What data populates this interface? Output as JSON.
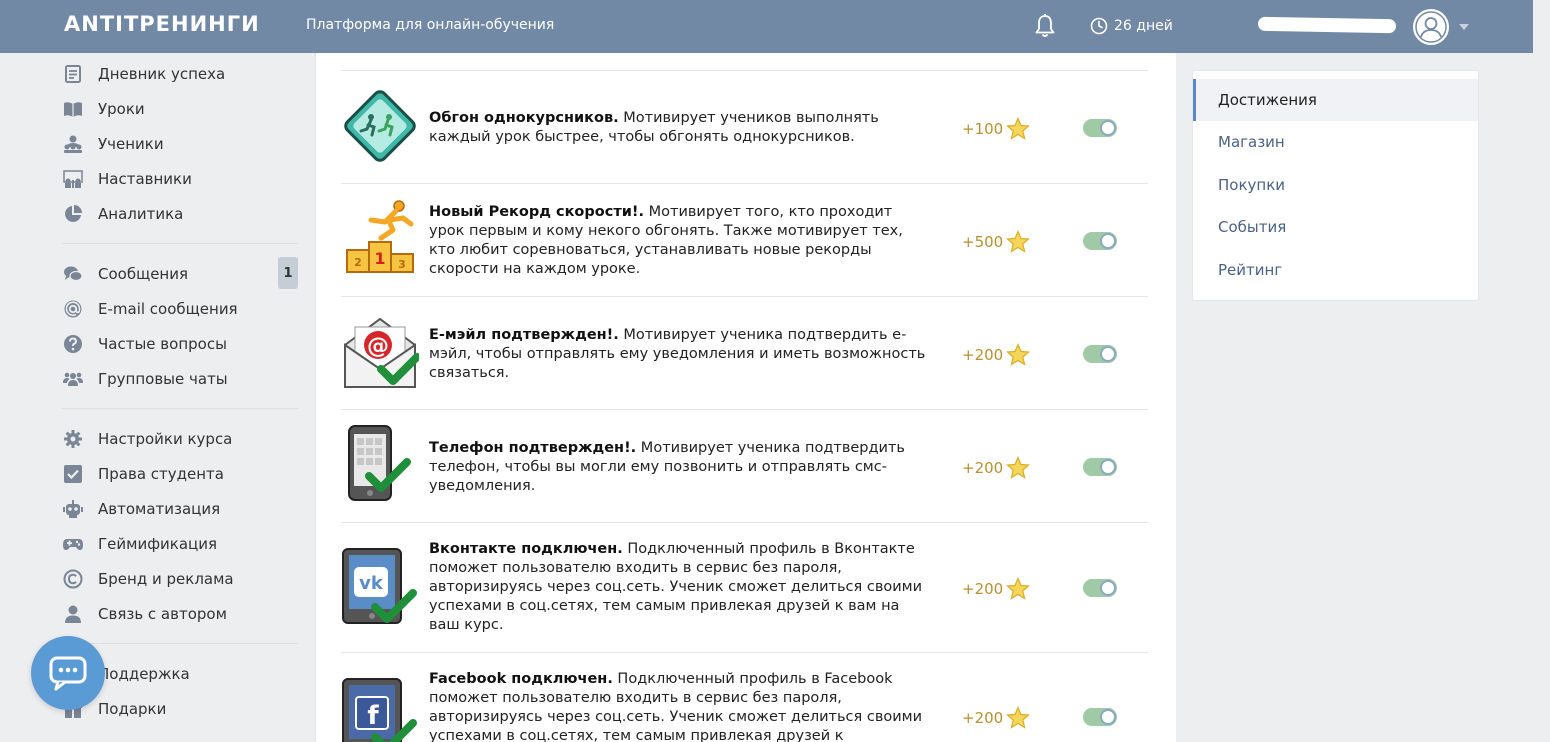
{
  "header": {
    "logo": "ANTITРЕНИНГИ",
    "tagline": "Платформа для онлайн-обучения",
    "days": "26 дней"
  },
  "sidebar": {
    "items": [
      {
        "label": "Дневник успеха",
        "icon": "diary-icon"
      },
      {
        "label": "Уроки",
        "icon": "book-icon"
      },
      {
        "label": "Ученики",
        "icon": "students-icon"
      },
      {
        "label": "Наставники",
        "icon": "mentors-icon"
      },
      {
        "label": "Аналитика",
        "icon": "pie-chart-icon"
      },
      {
        "label": "Сообщения",
        "icon": "messages-icon",
        "badge": "1"
      },
      {
        "label": "E-mail сообщения",
        "icon": "at-sign-icon"
      },
      {
        "label": "Частые вопросы",
        "icon": "question-icon"
      },
      {
        "label": "Групповые чаты",
        "icon": "group-icon"
      },
      {
        "label": "Настройки курса",
        "icon": "gear-icon"
      },
      {
        "label": "Права студента",
        "icon": "checkbox-icon"
      },
      {
        "label": "Автоматизация",
        "icon": "robot-icon"
      },
      {
        "label": "Геймификация",
        "icon": "gamepad-icon"
      },
      {
        "label": "Бренд и реклама",
        "icon": "copyright-icon"
      },
      {
        "label": "Связь с автором",
        "icon": "user-icon"
      },
      {
        "label": "Поддержка",
        "icon": "support-icon"
      },
      {
        "label": "Подарки",
        "icon": "gift-icon"
      }
    ]
  },
  "achievements": [
    {
      "title": "Обгон однокурсников.",
      "text": " Мотивирует учеников выполнять каждый урок быстрее, чтобы обгонять однокурсников.",
      "points": "+100"
    },
    {
      "title": "Новый Рекорд скорости!.",
      "text": " Мотивирует того, кто проходит урок первым и кому некого обгонять. Также мотивирует тех, кто любит соревноваться, устанавливать новые рекорды скорости на каждом уроке.",
      "points": "+500"
    },
    {
      "title": "Е-мэйл подтвержден!.",
      "text": " Мотивирует ученика подтвердить е-мэйл, чтобы отправлять ему уведомления и иметь возможность связаться.",
      "points": "+200"
    },
    {
      "title": "Телефон подтвержден!.",
      "text": " Мотивирует ученика подтвердить телефон, чтобы вы могли ему позвонить и отправлять смс-уведомления.",
      "points": "+200"
    },
    {
      "title": "Вконтакте подключен.",
      "text": " Подключенный профиль в Вконтакте поможет пользователю входить в сервис без пароля, авторизируясь через соц.сеть. Ученик сможет делиться своими успехами в соц.сетях, тем самым привлекая друзей к вам на ваш курс.",
      "points": "+200"
    },
    {
      "title": "Facebook подключен.",
      "text": " Подключенный профиль в Facebook поможет пользователю входить в сервис без пароля, авторизируясь через соц.сеть. Ученик сможет делиться своими успехами в соц.сетях, тем самым привлекая друзей к",
      "points": "+200"
    }
  ],
  "right_menu": {
    "items": [
      "Достижения",
      "Магазин",
      "Покупки",
      "События",
      "Рейтинг"
    ]
  },
  "colors": {
    "header": "#7289a5",
    "accent": "#5b87c5",
    "points": "#b8902f",
    "toggle_on": "#9fcaa5"
  }
}
